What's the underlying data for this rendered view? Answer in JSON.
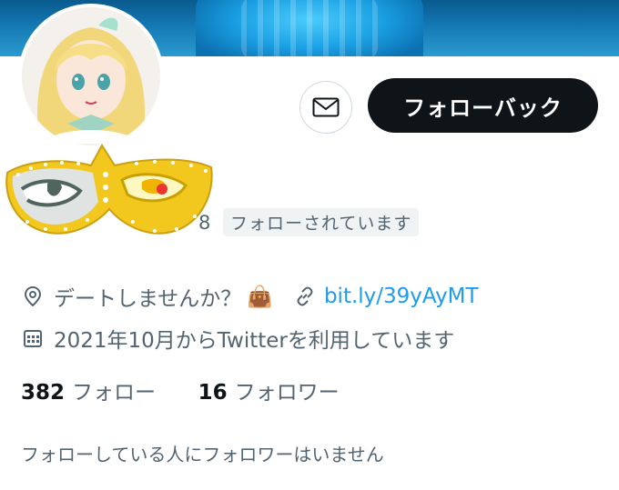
{
  "profile": {
    "avatar_icon": "avatar",
    "follow_back_label": "フォローバック",
    "message_icon": "envelope-icon",
    "count_fragment": "8",
    "follows_you_badge": "フォローされています",
    "location_icon": "location-pin-icon",
    "location": "デートしませんか？",
    "location_emoji": "👜",
    "link_icon": "link-icon",
    "link": "bit.ly/39yAyMT",
    "joined_icon": "calendar-icon",
    "joined": "2021年10月からTwitterを利用しています",
    "following_count": "382",
    "following_label": "フォロー",
    "followers_count": "16",
    "followers_label": "フォロワー",
    "mutuals_note": "フォローしている人にフォロワーはいません"
  },
  "colors": {
    "text_primary": "#0f1419",
    "text_secondary": "#536471",
    "link": "#1d9bf0",
    "button_dark": "#0f1419",
    "badge_bg": "#eff3f4"
  }
}
